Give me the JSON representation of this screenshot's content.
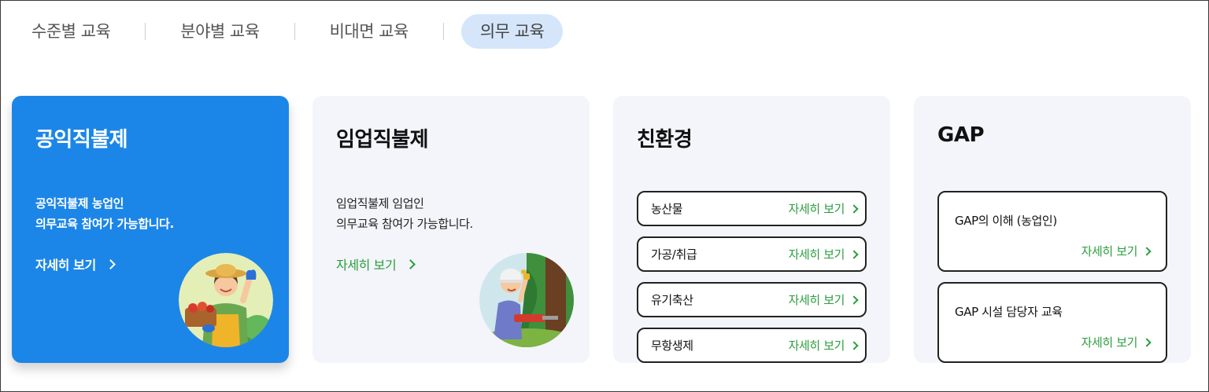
{
  "tabs": [
    {
      "label": "수준별 교육"
    },
    {
      "label": "분야별 교육"
    },
    {
      "label": "비대면 교육"
    },
    {
      "label": "의무 교육"
    }
  ],
  "active_tab": "의무 교육",
  "cards": {
    "public": {
      "title": "공익직불제",
      "desc_line1": "공익직불제 농업인",
      "desc_line2": "의무교육 참여가 가능합니다.",
      "link": "자세히 보기"
    },
    "forestry": {
      "title": "임업직불제",
      "desc_line1": "임업직불제 임업인",
      "desc_line2": "의무교육 참여가 가능합니다.",
      "link": "자세히 보기"
    },
    "eco": {
      "title": "친환경",
      "items": [
        {
          "label": "농산물",
          "link": "자세히 보기"
        },
        {
          "label": "가공/취급",
          "link": "자세히 보기"
        },
        {
          "label": "유기축산",
          "link": "자세히 보기"
        },
        {
          "label": "무항생제",
          "link": "자세히 보기"
        }
      ]
    },
    "gap": {
      "title": "GAP",
      "items": [
        {
          "label": "GAP의 이해 (농업인)",
          "link": "자세히 보기"
        },
        {
          "label": "GAP 시설 담당자 교육",
          "link": "자세히 보기"
        }
      ]
    }
  },
  "colors": {
    "accent_blue": "#1c86e8",
    "active_tab_bg": "#d5e6fb",
    "link_green": "#2a9d3c",
    "card_bg": "#f3f5fa"
  }
}
